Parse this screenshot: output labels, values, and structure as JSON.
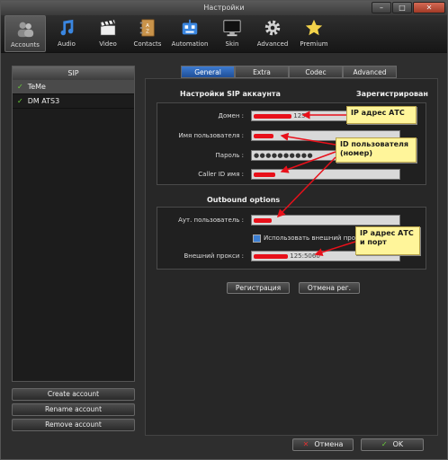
{
  "window": {
    "title": "Настройки"
  },
  "toolbar": {
    "items": [
      {
        "label": "Accounts",
        "icon": "accounts-icon"
      },
      {
        "label": "Audio",
        "icon": "music-note-icon"
      },
      {
        "label": "Video",
        "icon": "clapperboard-icon"
      },
      {
        "label": "Contacts",
        "icon": "address-book-icon"
      },
      {
        "label": "Automation",
        "icon": "robot-icon"
      },
      {
        "label": "Skin",
        "icon": "monitor-icon"
      },
      {
        "label": "Advanced",
        "icon": "gear-icon"
      },
      {
        "label": "Premium",
        "icon": "star-icon"
      }
    ],
    "active": "Accounts"
  },
  "accounts": {
    "header": "SIP",
    "list": [
      {
        "name": "TeMe",
        "checked": true
      },
      {
        "name": "DM ATS3",
        "checked": true
      }
    ],
    "create_label": "Create account",
    "rename_label": "Rename account",
    "remove_label": "Remove account"
  },
  "tabs": [
    {
      "label": "General",
      "active": true
    },
    {
      "label": "Extra",
      "active": false
    },
    {
      "label": "Codec",
      "active": false
    },
    {
      "label": "Advanced",
      "active": false
    }
  ],
  "sip": {
    "title": "Настройки SIP аккаунта",
    "status": "Зарегистрирован",
    "domain_label": "Домен :",
    "domain_value_tail": "125",
    "username_label": "Имя пользователя :",
    "password_label": "Пароль :",
    "password_value": "●●●●●●●●●●",
    "callerid_label": "Caller ID имя :"
  },
  "outbound": {
    "title": "Outbound options",
    "authuser_label": "Аут. пользователь :",
    "use_proxy_label": "Использовать внешний прокси",
    "proxy_label": "Внешний прокси :",
    "proxy_value_tail": "125:5060"
  },
  "buttons": {
    "register": "Регистрация",
    "unregister": "Отмена рег.",
    "cancel": "Отмена",
    "ok": "OK"
  },
  "notes": {
    "ip": "IP адрес АТС",
    "userid": "ID пользователя\n(номер)",
    "ipport": "IP адрес АТС\nи порт"
  },
  "colors": {
    "accent": "#2f6bc4",
    "redaction": "#e8101a",
    "note": "#fff59a"
  }
}
